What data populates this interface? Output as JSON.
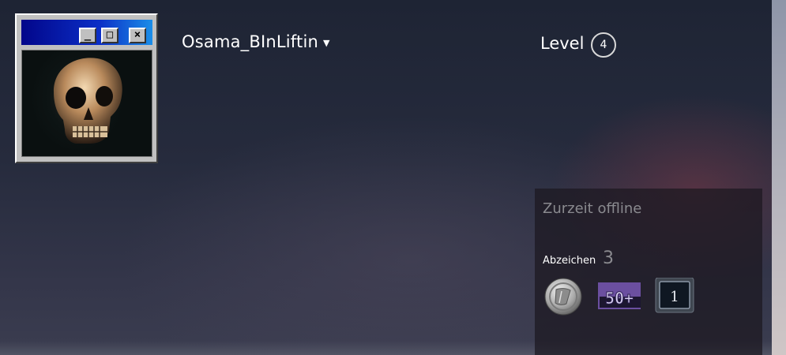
{
  "profile": {
    "username": "Osama_BInLiftin",
    "level_label": "Level",
    "level_value": "4"
  },
  "avatar": {
    "window_buttons": [
      "_",
      "□",
      "×"
    ]
  },
  "status": {
    "text": "Zurzeit offline"
  },
  "badges": {
    "title": "Abzeichen",
    "count": "3",
    "items": [
      {
        "icon": "silver-coin-badge-icon"
      },
      {
        "icon": "50-plus-badge-icon",
        "label": "50+"
      },
      {
        "icon": "years-of-service-badge-icon",
        "label": "1"
      }
    ]
  },
  "colors": {
    "background": "#262b3d",
    "panel": "#1c1820",
    "muted_text": "#8a8a8f",
    "titlebar": "#0b2fc7"
  }
}
